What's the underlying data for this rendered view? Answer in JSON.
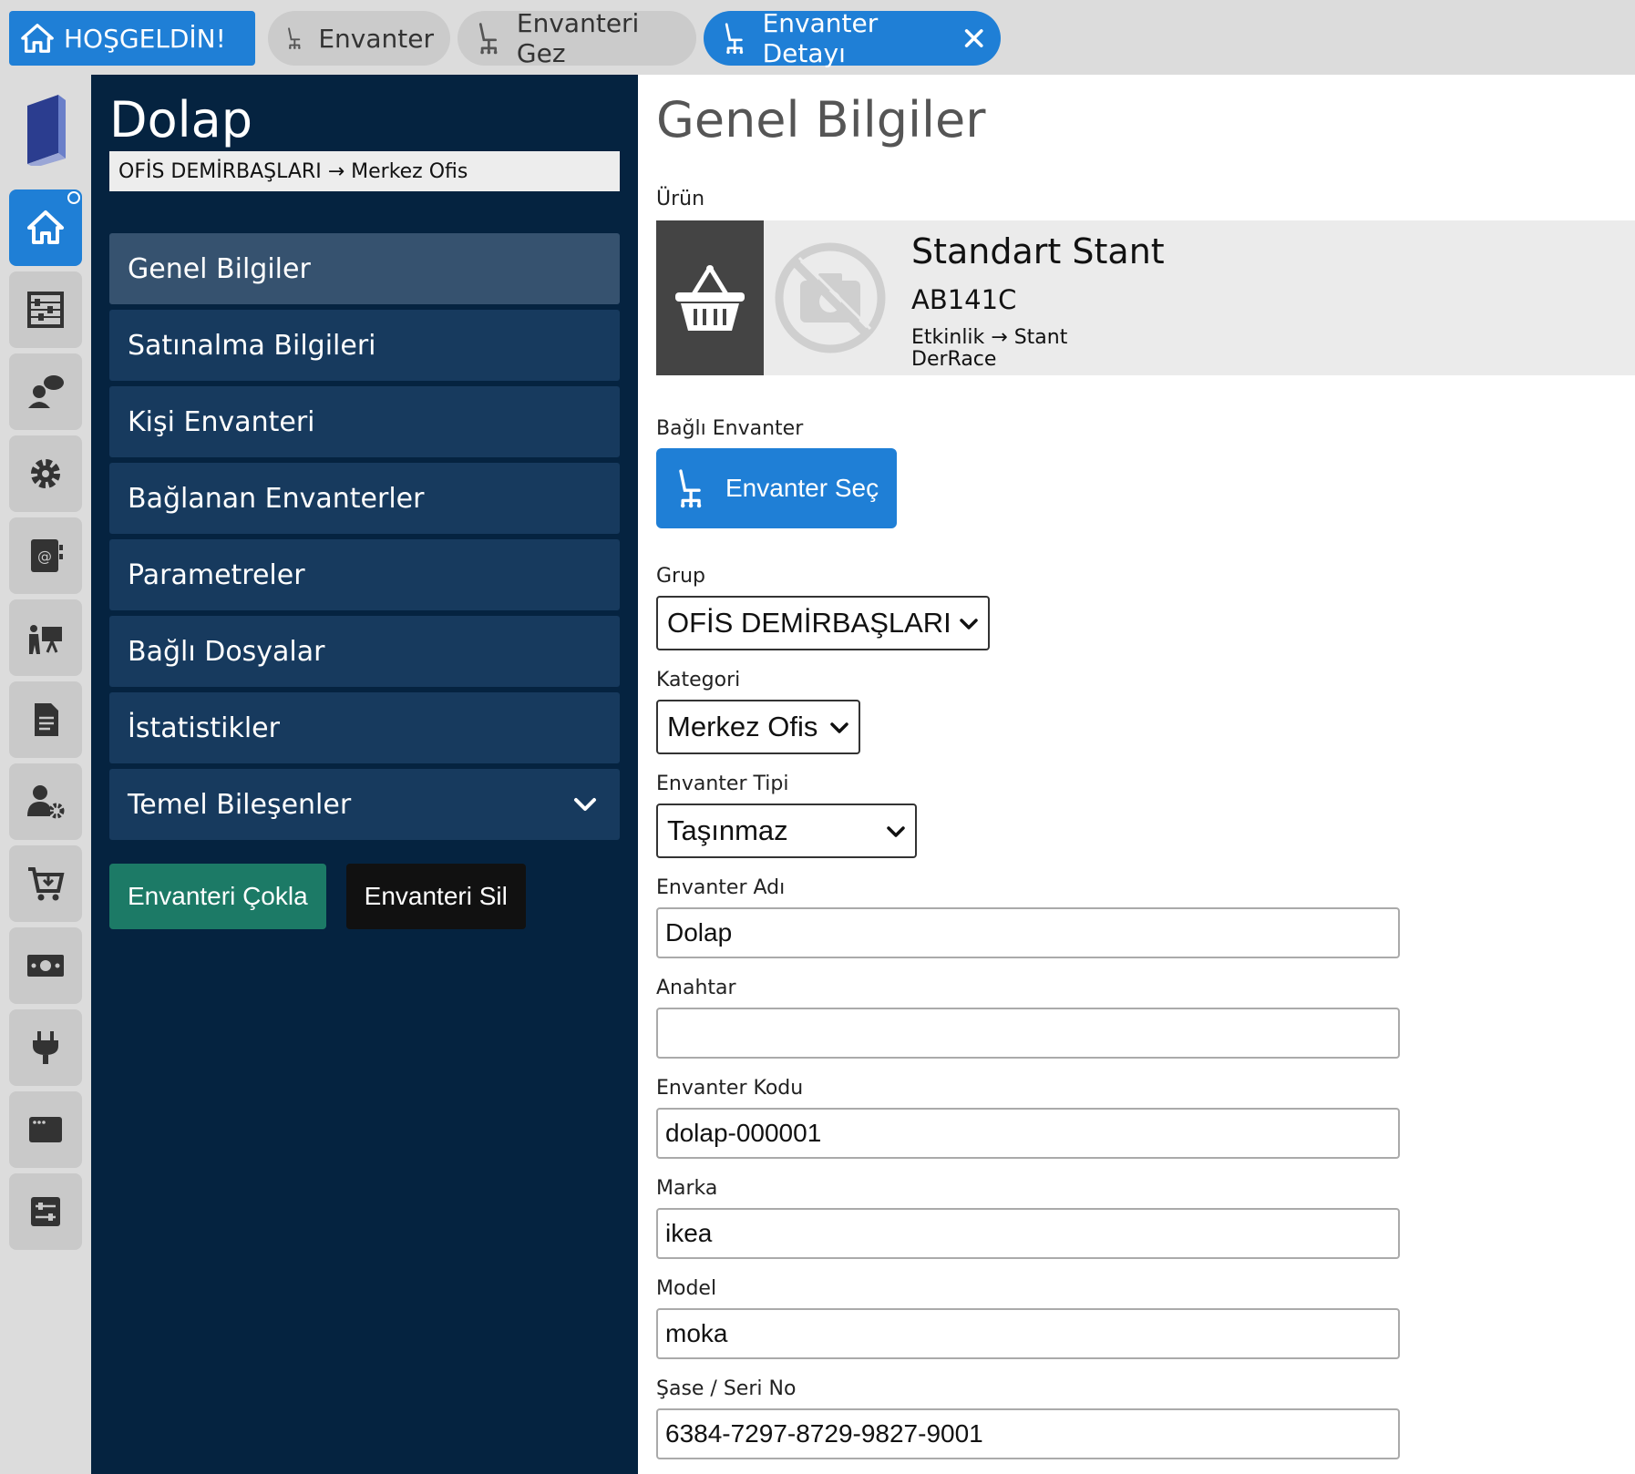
{
  "tabs": {
    "home": "HOŞGELDİN!",
    "items": [
      {
        "label": "Envanter"
      },
      {
        "label": "Envanteri Gez"
      },
      {
        "label": "Envanter Detayı"
      }
    ]
  },
  "sidebar": {
    "title": "Dolap",
    "breadcrumb": "OFİS DEMİRBAŞLARI → Merkez Ofis",
    "menu": [
      {
        "label": "Genel Bilgiler"
      },
      {
        "label": "Satınalma Bilgileri"
      },
      {
        "label": "Kişi Envanteri"
      },
      {
        "label": "Bağlanan Envanterler"
      },
      {
        "label": "Parametreler"
      },
      {
        "label": "Bağlı Dosyalar"
      },
      {
        "label": "İstatistikler"
      },
      {
        "label": "Temel Bileşenler"
      }
    ],
    "clone_label": "Envanteri Çokla",
    "delete_label": "Envanteri Sil"
  },
  "main": {
    "title": "Genel Bilgiler",
    "product_label": "Ürün",
    "product": {
      "name": "Standart Stant",
      "code": "AB141C",
      "category": "Etkinlik → Stant",
      "brand": "DerRace"
    },
    "linked_label": "Bağlı Envanter",
    "select_button": "Envanter Seç",
    "group_label": "Grup",
    "group_value": "OFİS DEMİRBAŞLARI",
    "category_label": "Kategori",
    "category_value": "Merkez Ofis",
    "type_label": "Envanter Tipi",
    "type_value": "Taşınmaz",
    "name_label": "Envanter Adı",
    "name_value": "Dolap",
    "key_label": "Anahtar",
    "key_value": "",
    "code_label": "Envanter Kodu",
    "code_value": "dolap-000001",
    "brand_label": "Marka",
    "brand_value": "ikea",
    "model_label": "Model",
    "model_value": "moka",
    "serial_label": "Şase / Seri No",
    "serial_value": "6384-7297-8729-9827-9001"
  },
  "colors": {
    "accent": "#1f7fd6",
    "sidebar_bg": "#052340",
    "menu_bg": "#173a5e",
    "menu_active": "#36526f",
    "clone_btn": "#1c7a66"
  }
}
